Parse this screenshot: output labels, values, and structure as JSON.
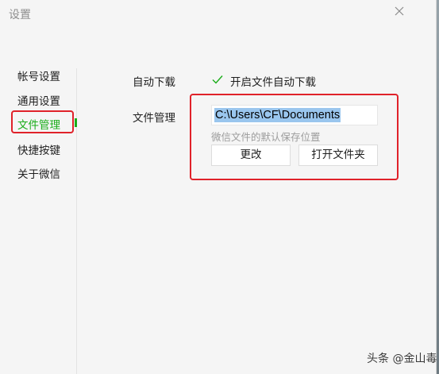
{
  "window": {
    "title": "设置",
    "close_icon": "close-icon"
  },
  "sidebar": {
    "items": [
      {
        "label": "帐号设置",
        "active": false
      },
      {
        "label": "通用设置",
        "active": false
      },
      {
        "label": "文件管理",
        "active": true
      },
      {
        "label": "快捷按键",
        "active": false
      },
      {
        "label": "关于微信",
        "active": false
      }
    ]
  },
  "settings": {
    "auto_download": {
      "label": "自动下载",
      "checkbox_label": "开启文件自动下载",
      "checked": true
    },
    "file_management": {
      "label": "文件管理",
      "path": "C:\\Users\\CF\\Documents",
      "hint": "微信文件的默认保存位置",
      "change_button": "更改",
      "open_folder_button": "打开文件夹"
    }
  },
  "watermark": "头条 @金山毒霸",
  "colors": {
    "accent": "#1aad19",
    "highlight_border": "#e0222a",
    "selection": "#9ac6ee"
  }
}
